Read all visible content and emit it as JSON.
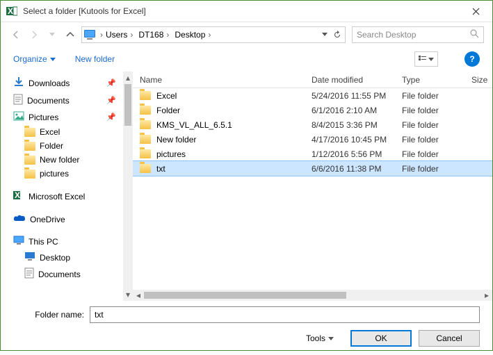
{
  "title": "Select a folder [Kutools for Excel]",
  "breadcrumb": [
    "Users",
    "DT168",
    "Desktop"
  ],
  "search": {
    "placeholder": "Search Desktop"
  },
  "toolbar": {
    "organize": "Organize",
    "new_folder": "New folder"
  },
  "tree": {
    "items": [
      {
        "label": "Downloads",
        "icon": "download",
        "pinned": true
      },
      {
        "label": "Documents",
        "icon": "doc",
        "pinned": true
      },
      {
        "label": "Pictures",
        "icon": "pic",
        "pinned": true
      },
      {
        "label": "Excel",
        "icon": "folder",
        "pinned": false,
        "sub": true
      },
      {
        "label": "Folder",
        "icon": "folder",
        "pinned": false,
        "sub": true
      },
      {
        "label": "New folder",
        "icon": "folder",
        "pinned": false,
        "sub": true
      },
      {
        "label": "pictures",
        "icon": "folder",
        "pinned": false,
        "sub": true
      }
    ],
    "excel": "Microsoft Excel",
    "onedrive": "OneDrive",
    "thispc": "This PC",
    "desktop": "Desktop",
    "documents": "Documents"
  },
  "columns": {
    "name": "Name",
    "date": "Date modified",
    "type": "Type",
    "size": "Size"
  },
  "rows": [
    {
      "name": "Excel",
      "date": "5/24/2016 11:55 PM",
      "type": "File folder"
    },
    {
      "name": "Folder",
      "date": "6/1/2016 2:10 AM",
      "type": "File folder"
    },
    {
      "name": "KMS_VL_ALL_6.5.1",
      "date": "8/4/2015 3:36 PM",
      "type": "File folder"
    },
    {
      "name": "New folder",
      "date": "4/17/2016 10:45 PM",
      "type": "File folder"
    },
    {
      "name": "pictures",
      "date": "1/12/2016 5:56 PM",
      "type": "File folder"
    },
    {
      "name": "txt",
      "date": "6/6/2016 11:38 PM",
      "type": "File folder",
      "selected": true
    }
  ],
  "footer": {
    "label": "Folder name:",
    "value": "txt",
    "tools": "Tools",
    "ok": "OK",
    "cancel": "Cancel"
  }
}
